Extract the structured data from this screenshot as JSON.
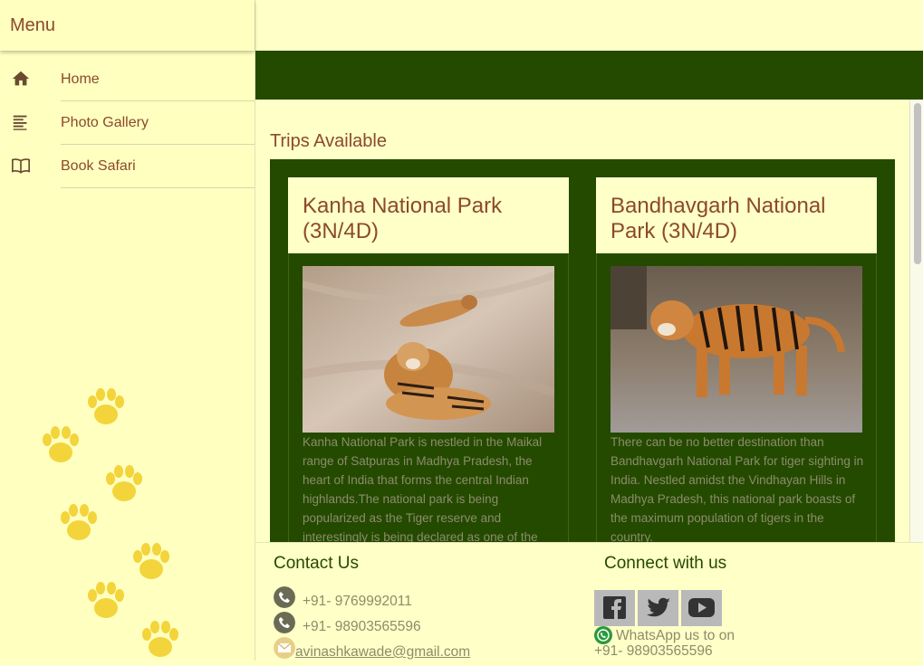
{
  "sidebar": {
    "title": "Menu",
    "items": [
      {
        "label": "Home",
        "icon": "home-icon"
      },
      {
        "label": "Photo Gallery",
        "icon": "list-icon"
      },
      {
        "label": "Book Safari",
        "icon": "book-icon"
      }
    ]
  },
  "main": {
    "section_title": "Trips Available",
    "cards": [
      {
        "title": "Kanha National Park (3N/4D)",
        "image": "tigers-resting-on-sand-photo",
        "text": "Kanha National Park is nestled in the Maikal range of Satpuras in Madhya Pradesh, the heart of India that forms the central Indian highlands.The national park is being popularized as the Tiger reserve and interestingly is being declared as one of the"
      },
      {
        "title": "Bandhavgarh National Park (3N/4D)",
        "image": "tiger-walking-photo",
        "text": "There can be no better destination than Bandhavgarh National Park for tiger sighting in India. Nestled amidst the Vindhayan Hills in Madhya Pradesh, this national park boasts of the maximum population of tigers in the country."
      }
    ]
  },
  "footer": {
    "contact_title": "Contact Us",
    "phone1": "+91- 9769992011",
    "phone2": "+91- 98903565596",
    "email": "avinashkawade@gmail.com",
    "connect_title": "Connect with us",
    "social": [
      "facebook-icon",
      "twitter-icon",
      "youtube-icon"
    ],
    "whatsapp_line1": "WhatsApp us to on",
    "whatsapp_line2": "+91- 98903565596"
  },
  "colors": {
    "background": "#ffffc8",
    "accent_green": "#244a00",
    "text_brown": "#8b4a2b",
    "paw_yellow": "#f3d43b"
  }
}
